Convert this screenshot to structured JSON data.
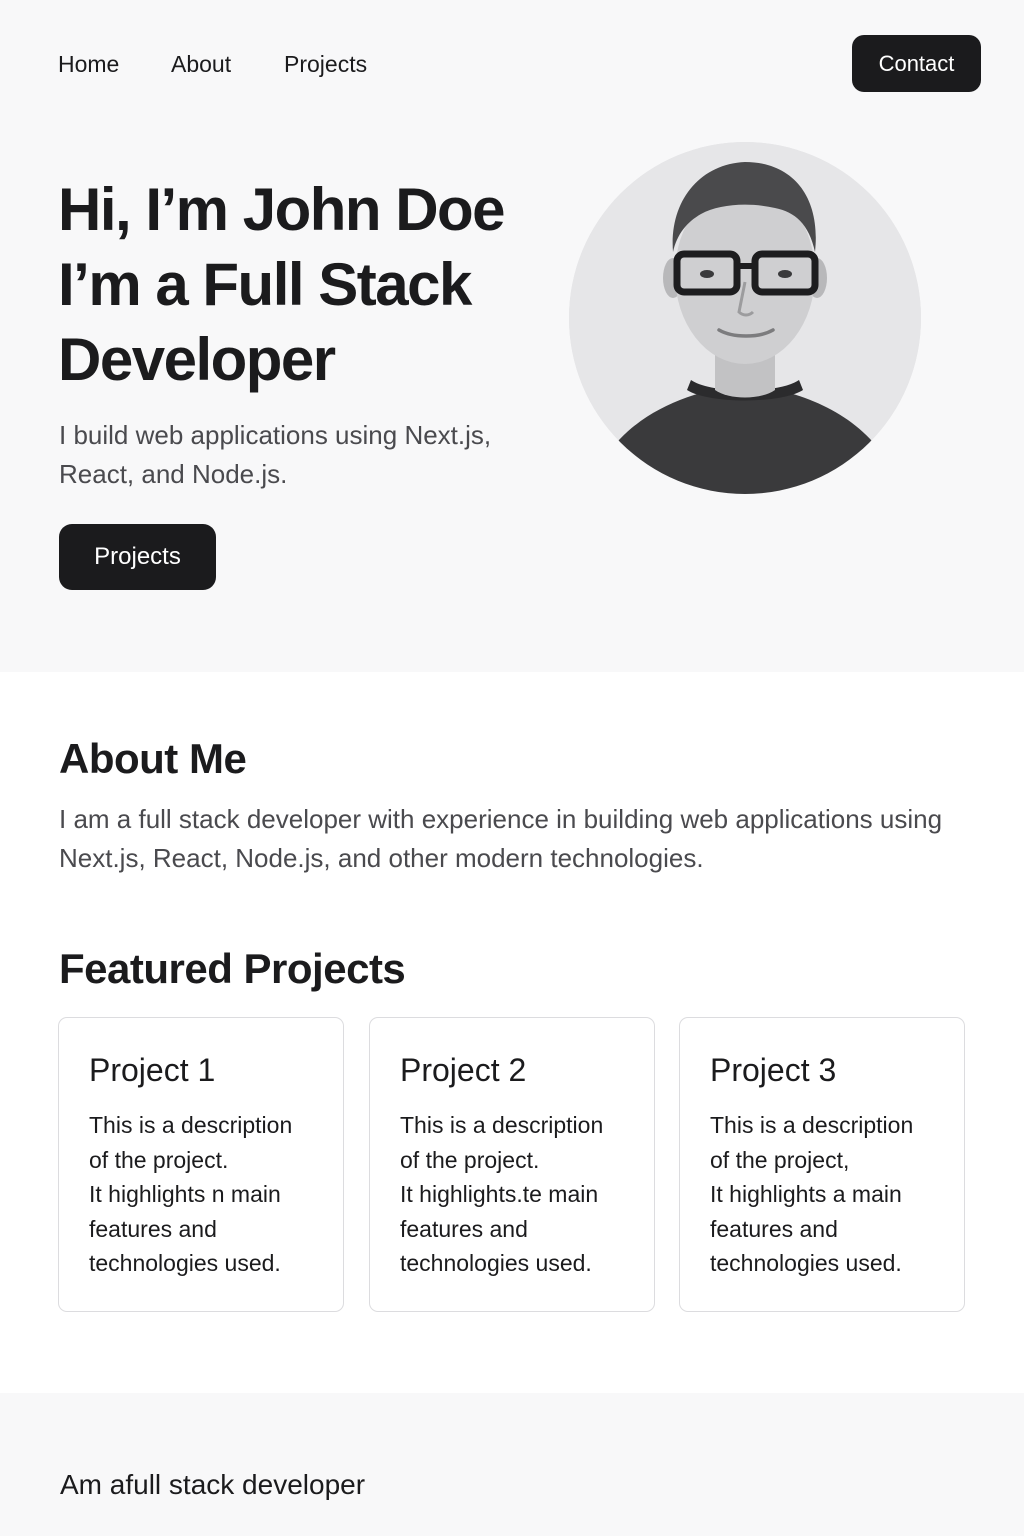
{
  "nav": {
    "home": "Home",
    "about": "About",
    "projects": "Projects",
    "contact": "Contact"
  },
  "hero": {
    "title_line1": "Hi, I’m John Doe",
    "title_line2": "I’m a Full Stack",
    "title_line3": "Developer",
    "subtitle": "I build web applications using Next.js, React, and Node.js.",
    "button": "Projects"
  },
  "about": {
    "title": "About Me",
    "text": "I am a full stack developer with experience in building web applications using Next.js, React, Node.js, and other modern technologies."
  },
  "projects": {
    "title": "Featured Projects",
    "items": [
      {
        "title": "Project 1",
        "lines": [
          "This is a description",
          "of the project.",
          "It highlights n main",
          "features and",
          "technologies used."
        ]
      },
      {
        "title": "Project 2",
        "lines": [
          "This is a description",
          "of the project.",
          "It highlights.te main",
          "features and",
          "technologies used."
        ]
      },
      {
        "title": "Project 3",
        "lines": [
          "This is a description",
          "of the project,",
          "It highlights a main",
          "features and",
          "technologies used."
        ]
      }
    ]
  },
  "footer": {
    "text": "Am a​full stack developer"
  },
  "colors": {
    "text": "#1b1b1d",
    "muted": "#4a4a4e",
    "button_bg": "#1b1b1d",
    "hero_bg": "#f8f8f9",
    "card_border": "#dcdcdf"
  }
}
